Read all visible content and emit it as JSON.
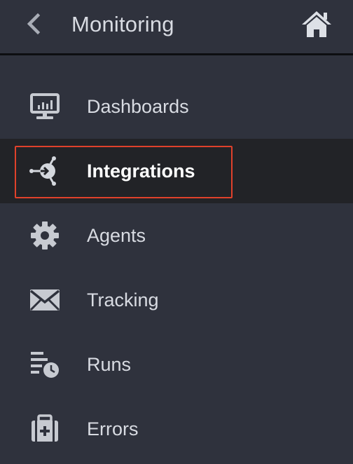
{
  "header": {
    "title": "Monitoring",
    "back_icon": "chevron-left-icon",
    "home_icon": "home-icon"
  },
  "nav": {
    "items": [
      {
        "label": "Dashboards",
        "icon": "monitor-chart-icon",
        "active": false
      },
      {
        "label": "Integrations",
        "icon": "integrations-icon",
        "active": true
      },
      {
        "label": "Agents",
        "icon": "gear-icon",
        "active": false
      },
      {
        "label": "Tracking",
        "icon": "envelope-icon",
        "active": false
      },
      {
        "label": "Runs",
        "icon": "list-clock-icon",
        "active": false
      },
      {
        "label": "Errors",
        "icon": "first-aid-kit-icon",
        "active": false
      }
    ]
  },
  "colors": {
    "background": "#2f323d",
    "active_background": "#222327",
    "text": "#d8dbe2",
    "active_text": "#ffffff",
    "icon": "#c7cad1",
    "highlight": "#e0412b",
    "divider": "#0d0e11"
  }
}
